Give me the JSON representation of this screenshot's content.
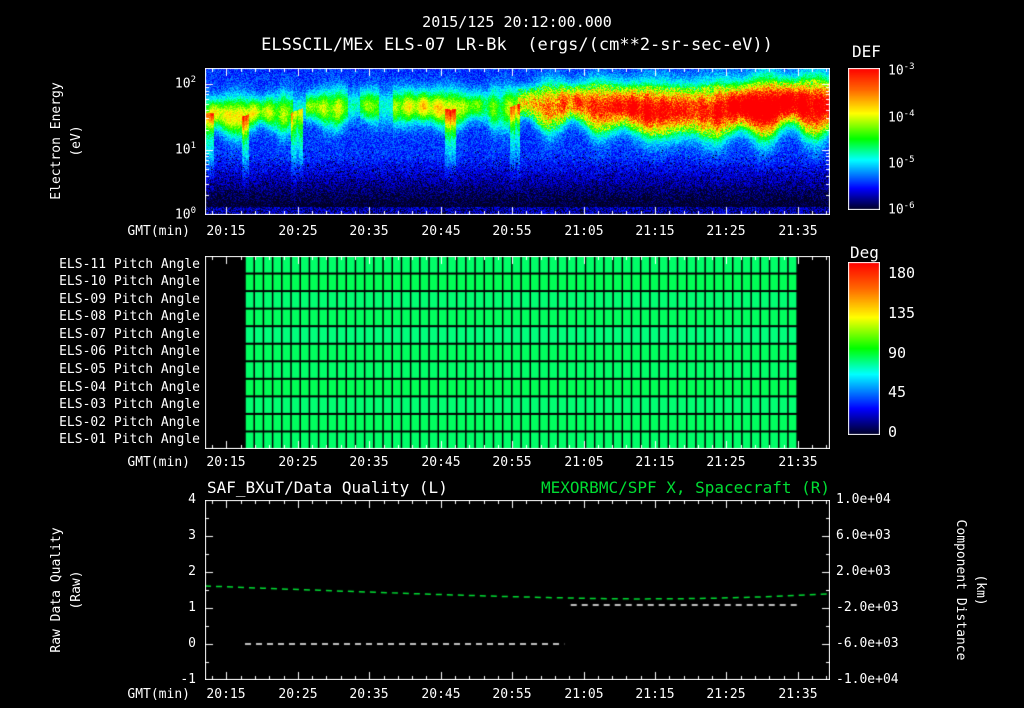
{
  "colors": {
    "background": "#000000",
    "text": "#ffffff",
    "accent_green": "#00dd33"
  },
  "header": {
    "title": "2015/125 20:12:00.000",
    "subtitle": "ELSSCIL/MEx ELS-07 LR-Bk  (ergs/(cm**2-sr-sec-eV))"
  },
  "time_axis": {
    "label": "GMT(min)",
    "start_min": 0,
    "end_min": 87.5,
    "tick_start_min": 3,
    "tick_step_min": 10,
    "minor_step_min": 2,
    "ticks": [
      "20:15",
      "20:25",
      "20:35",
      "20:45",
      "20:55",
      "21:05",
      "21:15",
      "21:25",
      "21:35"
    ]
  },
  "spectrogram": {
    "ylabel1": "Electron Energy",
    "ylabel2": "(eV)",
    "yticks": [
      {
        "base": "10",
        "exp": "2"
      },
      {
        "base": "10",
        "exp": "1"
      },
      {
        "base": "10",
        "exp": "0"
      }
    ],
    "colorbar": {
      "title": "DEF",
      "ticks": [
        {
          "base": "10",
          "exp": "-3"
        },
        {
          "base": "10",
          "exp": "-4"
        },
        {
          "base": "10",
          "exp": "-5"
        },
        {
          "base": "10",
          "exp": "-6"
        }
      ]
    }
  },
  "pitch": {
    "rows": [
      "ELS-11 Pitch Angle",
      "ELS-10 Pitch Angle",
      "ELS-09 Pitch Angle",
      "ELS-08 Pitch Angle",
      "ELS-07 Pitch Angle",
      "ELS-06 Pitch Angle",
      "ELS-05 Pitch Angle",
      "ELS-04 Pitch Angle",
      "ELS-03 Pitch Angle",
      "ELS-02 Pitch Angle",
      "ELS-01 Pitch Angle"
    ],
    "colorbar": {
      "title": "Deg",
      "ticks": [
        "180",
        "135",
        "90",
        "45",
        "0"
      ]
    }
  },
  "bottom": {
    "title_left": "SAF_BXuT/Data Quality (L)",
    "title_right": "MEXORBMC/SPF X, Spacecraft (R)",
    "ylabel_left1": "Raw Data Quality",
    "ylabel_left2": "(Raw)",
    "ylabel_right1": "Component Distance",
    "ylabel_right2": "(km)",
    "yticks_left": [
      "4",
      "3",
      "2",
      "1",
      "0",
      "-1"
    ],
    "yticks_right": [
      "1.0e+04",
      "6.0e+03",
      "2.0e+03",
      "-2.0e+03",
      "-6.0e+03",
      "-1.0e+04"
    ]
  },
  "chart_data": [
    {
      "type": "heatmap",
      "name": "electron_energy_spectrogram",
      "title": "2015/125 20:12:00.000",
      "instrument": "ELSSCIL/MEx ELS-07 LR-Bk",
      "units": "ergs/(cm**2-sr-sec-eV)",
      "xlabel": "GMT(min)",
      "x_ticks": [
        "20:15",
        "20:25",
        "20:35",
        "20:45",
        "20:55",
        "21:05",
        "21:15",
        "21:25",
        "21:35"
      ],
      "ylabel": "Electron Energy (eV)",
      "y_scale": "log",
      "y_range_ev": [
        1,
        178
      ],
      "color_scale": "log",
      "color_range": [
        "1e-6",
        "1e-3"
      ],
      "colorbar_label": "DEF",
      "features": [
        "intense flux band between ~15 and ~90 eV across the whole interval",
        "patchy green-yellow band with vertical enhancements 20:12-20:55",
        "band brightens to orange-red from ~21:00 to 21:39",
        "blue low flux above and below the band",
        "dark speckled low-flux region below ~5 eV"
      ]
    },
    {
      "type": "heatmap",
      "name": "pitch_angle_panels",
      "rows": [
        "ELS-11 Pitch Angle",
        "ELS-10 Pitch Angle",
        "ELS-09 Pitch Angle",
        "ELS-08 Pitch Angle",
        "ELS-07 Pitch Angle",
        "ELS-06 Pitch Angle",
        "ELS-05 Pitch Angle",
        "ELS-04 Pitch Angle",
        "ELS-03 Pitch Angle",
        "ELS-02 Pitch Angle",
        "ELS-01 Pitch Angle"
      ],
      "value_deg_rows": [
        79,
        81,
        78,
        80,
        77,
        80,
        79,
        81,
        78,
        80,
        79
      ],
      "data_start_min": 5.6,
      "data_end_min": 82.9,
      "n_time_cells": 60,
      "colorbar_label": "Deg",
      "color_range_deg": [
        0,
        180
      ]
    },
    {
      "type": "line",
      "name": "quality_and_spacecraft_x",
      "title_left": "SAF_BXuT/Data Quality (L)",
      "title_right": "MEXORBMC/SPF X, Spacecraft (R)",
      "ylabel_left": "Raw Data Quality (Raw)",
      "ylabel_right": "Component Distance (km)",
      "ylim_left": [
        -1,
        4
      ],
      "ylim_right": [
        -10000,
        10000
      ],
      "series": [
        {
          "name": "MEXORBMC/SPF X Spacecraft",
          "axis": "right",
          "color": "#00dd33",
          "style": "dashed",
          "points_min_km": [
            [
              0,
              450
            ],
            [
              8,
              200
            ],
            [
              16,
              -30
            ],
            [
              24,
              -260
            ],
            [
              32,
              -480
            ],
            [
              40,
              -680
            ],
            [
              48,
              -840
            ],
            [
              54,
              -940
            ],
            [
              60,
              -990
            ],
            [
              66,
              -980
            ],
            [
              72,
              -900
            ],
            [
              78,
              -760
            ],
            [
              83,
              -580
            ],
            [
              87.5,
              -430
            ]
          ]
        },
        {
          "name": "SAF_BXuT Data Quality",
          "axis": "left",
          "color": "#ffffff",
          "style": "dashed",
          "segments": [
            {
              "value": 0,
              "from_min": 5.6,
              "to_min": 50.3
            },
            {
              "value": 1.08,
              "from_min": 51.2,
              "to_min": 83.2
            }
          ]
        }
      ]
    }
  ]
}
